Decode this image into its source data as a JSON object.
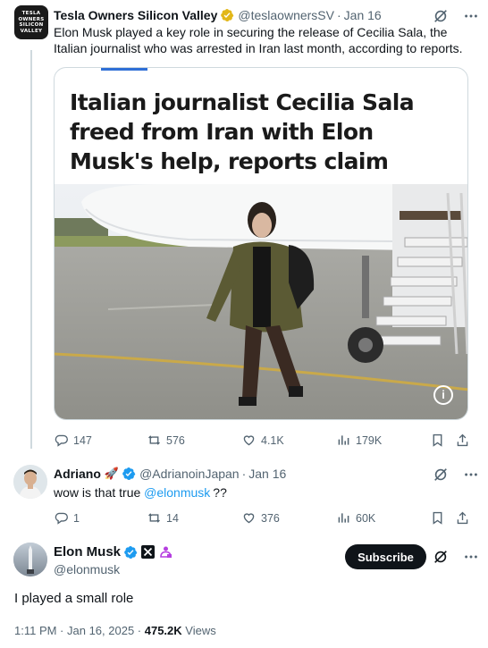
{
  "tweet1": {
    "avatar_text": [
      "TESLA",
      "OWNERS",
      "SILICON",
      "VALLEY"
    ],
    "name": "Tesla Owners Silicon Valley",
    "handle": "@teslaownersSV",
    "time": "Jan 16",
    "text": "Elon Musk played a key role in securing the release of Cecilia Sala, the Italian journalist who was arrested in Iran last month, according to reports.",
    "card": {
      "headline": "Italian journalist Cecilia Sala freed from Iran with Elon Musk's help, reports claim",
      "info_label": "i"
    },
    "stats": {
      "replies": "147",
      "reposts": "576",
      "likes": "4.1K",
      "views": "179K"
    }
  },
  "tweet2": {
    "name": "Adriano",
    "emoji": "🚀",
    "handle": "@AdrianoinJapan",
    "time": "Jan 16",
    "text_prefix": "wow is that true ",
    "mention": "@elonmusk",
    "text_suffix": "??",
    "stats": {
      "replies": "1",
      "reposts": "14",
      "likes": "376",
      "views": "60K"
    }
  },
  "tweet3": {
    "name": "Elon Musk",
    "handle": "@elonmusk",
    "subscribe_label": "Subscribe",
    "text": "I played a small role",
    "timestamp": "1:11 PM · Jan 16, 2025 · ",
    "views_count": "475.2K",
    "views_label": " Views"
  },
  "separator": "·",
  "colors": {
    "accent": "#1d9bf0",
    "verified_gold": "#e2b719",
    "verified_blue": "#1d9bf0",
    "muted": "#536471"
  }
}
